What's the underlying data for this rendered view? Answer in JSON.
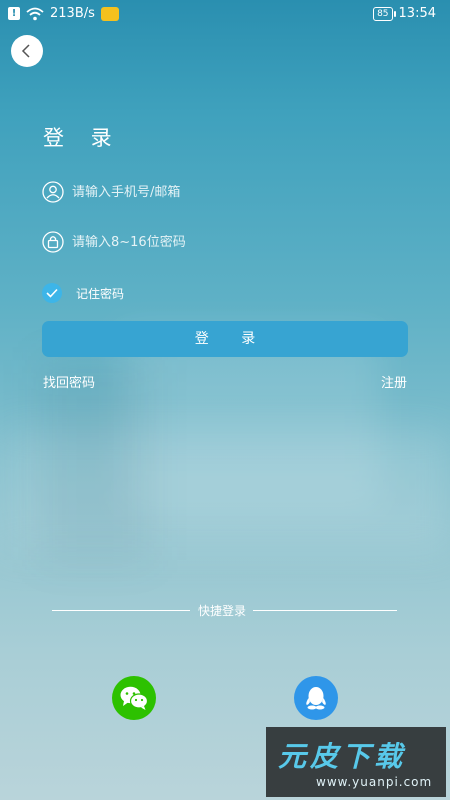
{
  "status_bar": {
    "notification": "!",
    "net_speed": "213B/s",
    "battery": "85",
    "time": "13:54"
  },
  "page": {
    "title": "登 录"
  },
  "form": {
    "account_placeholder": "请输入手机号/邮箱",
    "password_placeholder": "请输入8~16位密码",
    "remember_label": "记住密码",
    "remember_checked": true,
    "login_label": "登 录",
    "forgot_label": "找回密码",
    "register_label": "注册"
  },
  "quick_login": {
    "label": "快捷登录",
    "providers": [
      "wechat-icon",
      "qq-icon"
    ]
  },
  "watermark": {
    "brand": "元皮下载",
    "url": "www.yuanpi.com"
  },
  "colors": {
    "accent": "#37a4d2",
    "check": "#3db5e8",
    "wechat": "#2dc100",
    "qq": "#2f96e9"
  }
}
